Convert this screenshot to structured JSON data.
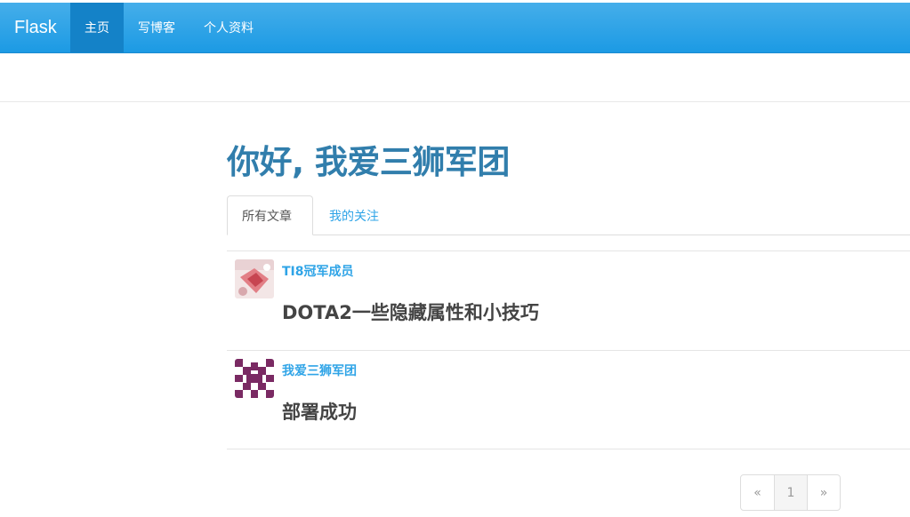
{
  "navbar": {
    "brand": "Flask",
    "items": [
      {
        "label": "主页",
        "active": true
      },
      {
        "label": "写博客",
        "active": false
      },
      {
        "label": "个人资料",
        "active": false
      }
    ]
  },
  "header": {
    "greeting": "你好, 我爱三狮军团"
  },
  "tabs": [
    {
      "label": "所有文章",
      "active": true
    },
    {
      "label": "我的关注",
      "active": false
    }
  ],
  "posts": [
    {
      "author": "TI8冠军成员",
      "title": "DOTA2一些隐藏属性和小技巧",
      "avatar": "photo-avatar-icon"
    },
    {
      "author": "我爱三狮军团",
      "title": "部署成功",
      "avatar": "identicon-avatar-icon"
    }
  ],
  "pagination": {
    "prev": "«",
    "current": "1",
    "next": "»"
  },
  "colors": {
    "navbar": "#2fa4e7",
    "active_nav": "#1482c8",
    "link": "#2fa4e7",
    "header": "#317eac"
  }
}
